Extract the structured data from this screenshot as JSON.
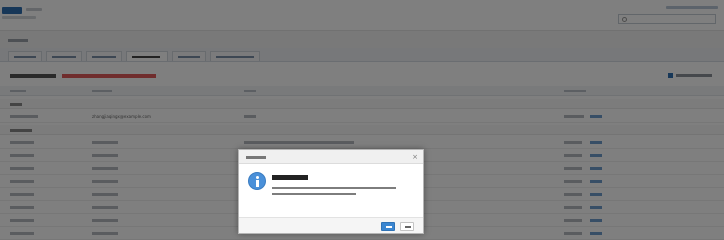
{
  "colors": {
    "accent": "#3a86d1",
    "warning_text": "#e05a5a",
    "link": "#6f9ccc"
  },
  "table": {
    "groups": [
      {
        "rows": [
          {
            "email": "zhangjiaqingx@example.com"
          }
        ]
      }
    ]
  },
  "dialog": {
    "icon": "info-icon"
  }
}
